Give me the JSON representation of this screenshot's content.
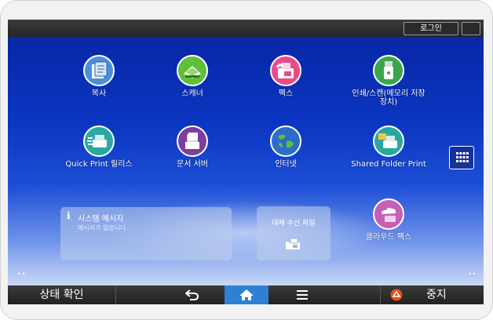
{
  "topbar": {
    "login_label": "로그인"
  },
  "apps": [
    {
      "label": "복사"
    },
    {
      "label": "스캐너"
    },
    {
      "label": "팩스"
    },
    {
      "label": "인쇄/스캔(메모리 저장\n장치)"
    },
    {
      "label": "Quick Print 릴리스"
    },
    {
      "label": "문서 서버"
    },
    {
      "label": "인터넷"
    },
    {
      "label": "Shared Folder Print"
    },
    {
      "label": "클라우드 팩스"
    }
  ],
  "system_message": {
    "title": "시스템 메시지",
    "message": "메시지가 없습니다."
  },
  "fax_reception": {
    "title": "대체 수신 파일"
  },
  "bottombar": {
    "status_label": "상태 확인",
    "stop_label": "중지"
  },
  "colors": {
    "screen_blue": "#0b36c2",
    "home_active": "#2e7fd6",
    "stop_orange": "#e8501c"
  }
}
